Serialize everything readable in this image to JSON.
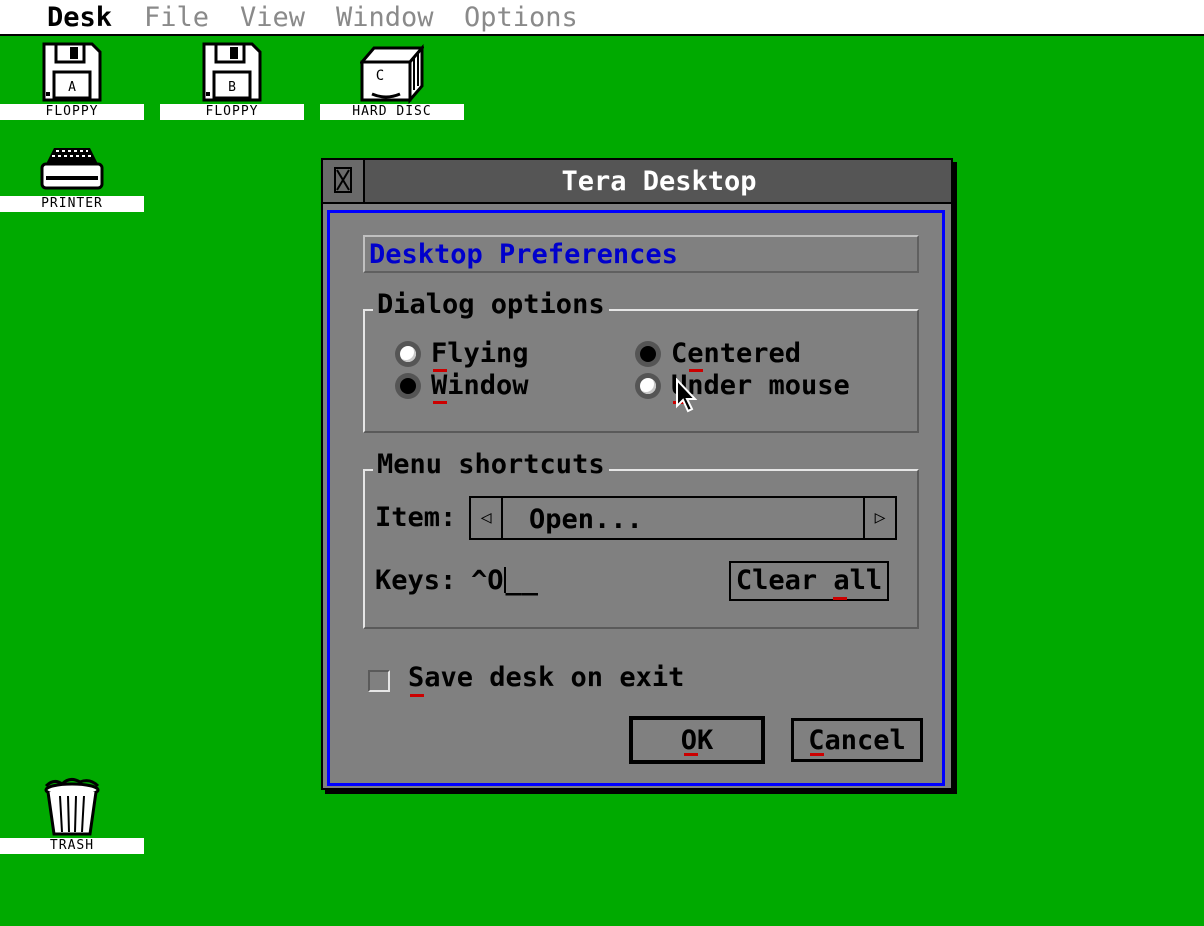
{
  "menubar": {
    "items": [
      {
        "label": "Desk",
        "active": true
      },
      {
        "label": "File",
        "active": false
      },
      {
        "label": "View",
        "active": false
      },
      {
        "label": "Window",
        "active": false
      },
      {
        "label": "Options",
        "active": false
      }
    ]
  },
  "desktop": {
    "icons": [
      {
        "label": "FLOPPY",
        "letter": "A",
        "icon": "floppy-icon"
      },
      {
        "label": "FLOPPY",
        "letter": "B",
        "icon": "floppy-icon"
      },
      {
        "label": "HARD DISC",
        "letter": "C",
        "icon": "hard-disc-icon"
      },
      {
        "label": "PRINTER",
        "icon": "printer-icon"
      },
      {
        "label": "TRASH",
        "icon": "trash-icon"
      }
    ],
    "background": "#00aa00"
  },
  "dialog": {
    "title": "Tera Desktop",
    "banner": "Desktop Preferences",
    "dialog_options": {
      "title": "Dialog options",
      "flying": {
        "label": "Flying",
        "selected": false
      },
      "window": {
        "label": "Window",
        "selected": true
      },
      "centered": {
        "label": "Centered",
        "selected": true
      },
      "under_mouse": {
        "label": "Under mouse",
        "selected": false
      }
    },
    "menu_shortcuts": {
      "title": "Menu shortcuts",
      "item_label": "Item:",
      "item_value": "Open...",
      "keys_label": "Keys:",
      "keys_value": "^O",
      "keys_blank": "__",
      "clear_all": "Clear all"
    },
    "save_desk": {
      "label": "Save desk on exit",
      "checked": false
    },
    "ok": "OK",
    "cancel": "Cancel"
  },
  "colors": {
    "accent_blue": "#0000ff",
    "shortcut_underline": "#cc0000",
    "dialog_gray": "#808080"
  }
}
